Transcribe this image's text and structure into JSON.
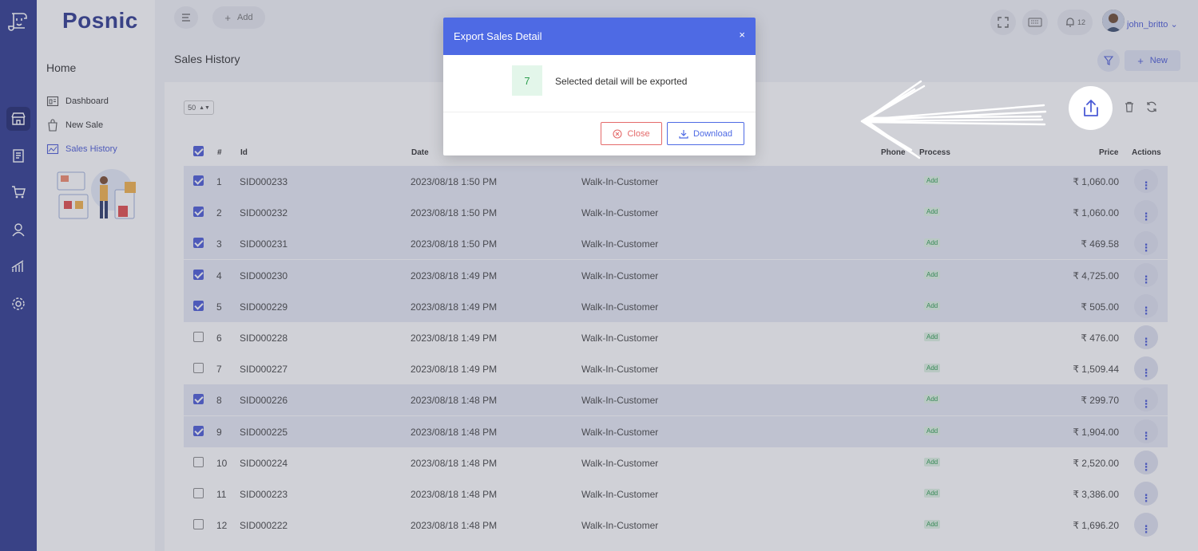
{
  "app": {
    "brand": "Posnic",
    "add_label": "Add",
    "notifications_count": "12",
    "user_name": "john_britto"
  },
  "nav": {
    "home_label": "Home",
    "items": [
      {
        "label": "Dashboard",
        "active": false
      },
      {
        "label": "New Sale",
        "active": false
      },
      {
        "label": "Sales History",
        "active": true
      }
    ]
  },
  "page": {
    "title": "Sales History",
    "new_label": "New",
    "page_size": "50"
  },
  "table": {
    "headers": {
      "index": "#",
      "id": "Id",
      "date": "Date",
      "phone": "Phone",
      "process": "Process",
      "price": "Price",
      "actions": "Actions"
    },
    "rows": [
      {
        "n": "1",
        "id": "SID000233",
        "date": "2023/08/18 1:50 PM",
        "customer": "Walk-In-Customer",
        "process": "Add",
        "price": "₹ 1,060.00",
        "selected": true
      },
      {
        "n": "2",
        "id": "SID000232",
        "date": "2023/08/18 1:50 PM",
        "customer": "Walk-In-Customer",
        "process": "Add",
        "price": "₹ 1,060.00",
        "selected": true
      },
      {
        "n": "3",
        "id": "SID000231",
        "date": "2023/08/18 1:50 PM",
        "customer": "Walk-In-Customer",
        "process": "Add",
        "price": "₹ 469.58",
        "selected": true
      },
      {
        "n": "4",
        "id": "SID000230",
        "date": "2023/08/18 1:49 PM",
        "customer": "Walk-In-Customer",
        "process": "Add",
        "price": "₹ 4,725.00",
        "selected": true
      },
      {
        "n": "5",
        "id": "SID000229",
        "date": "2023/08/18 1:49 PM",
        "customer": "Walk-In-Customer",
        "process": "Add",
        "price": "₹ 505.00",
        "selected": true
      },
      {
        "n": "6",
        "id": "SID000228",
        "date": "2023/08/18 1:49 PM",
        "customer": "Walk-In-Customer",
        "process": "Add",
        "price": "₹ 476.00",
        "selected": false
      },
      {
        "n": "7",
        "id": "SID000227",
        "date": "2023/08/18 1:49 PM",
        "customer": "Walk-In-Customer",
        "process": "Add",
        "price": "₹ 1,509.44",
        "selected": false
      },
      {
        "n": "8",
        "id": "SID000226",
        "date": "2023/08/18 1:48 PM",
        "customer": "Walk-In-Customer",
        "process": "Add",
        "price": "₹ 299.70",
        "selected": true
      },
      {
        "n": "9",
        "id": "SID000225",
        "date": "2023/08/18 1:48 PM",
        "customer": "Walk-In-Customer",
        "process": "Add",
        "price": "₹ 1,904.00",
        "selected": true
      },
      {
        "n": "10",
        "id": "SID000224",
        "date": "2023/08/18 1:48 PM",
        "customer": "Walk-In-Customer",
        "process": "Add",
        "price": "₹ 2,520.00",
        "selected": false
      },
      {
        "n": "11",
        "id": "SID000223",
        "date": "2023/08/18 1:48 PM",
        "customer": "Walk-In-Customer",
        "process": "Add",
        "price": "₹ 3,386.00",
        "selected": false
      },
      {
        "n": "12",
        "id": "SID000222",
        "date": "2023/08/18 1:48 PM",
        "customer": "Walk-In-Customer",
        "process": "Add",
        "price": "₹ 1,696.20",
        "selected": false
      }
    ]
  },
  "modal": {
    "title": "Export Sales Detail",
    "close_x": "×",
    "count": "7",
    "message": "Selected detail will be exported",
    "close_label": "Close",
    "download_label": "Download"
  },
  "colors": {
    "rail": "#2f3a8f",
    "accent": "#4e6ae4",
    "danger": "#e46a6a",
    "success": "#2e9e4f"
  }
}
